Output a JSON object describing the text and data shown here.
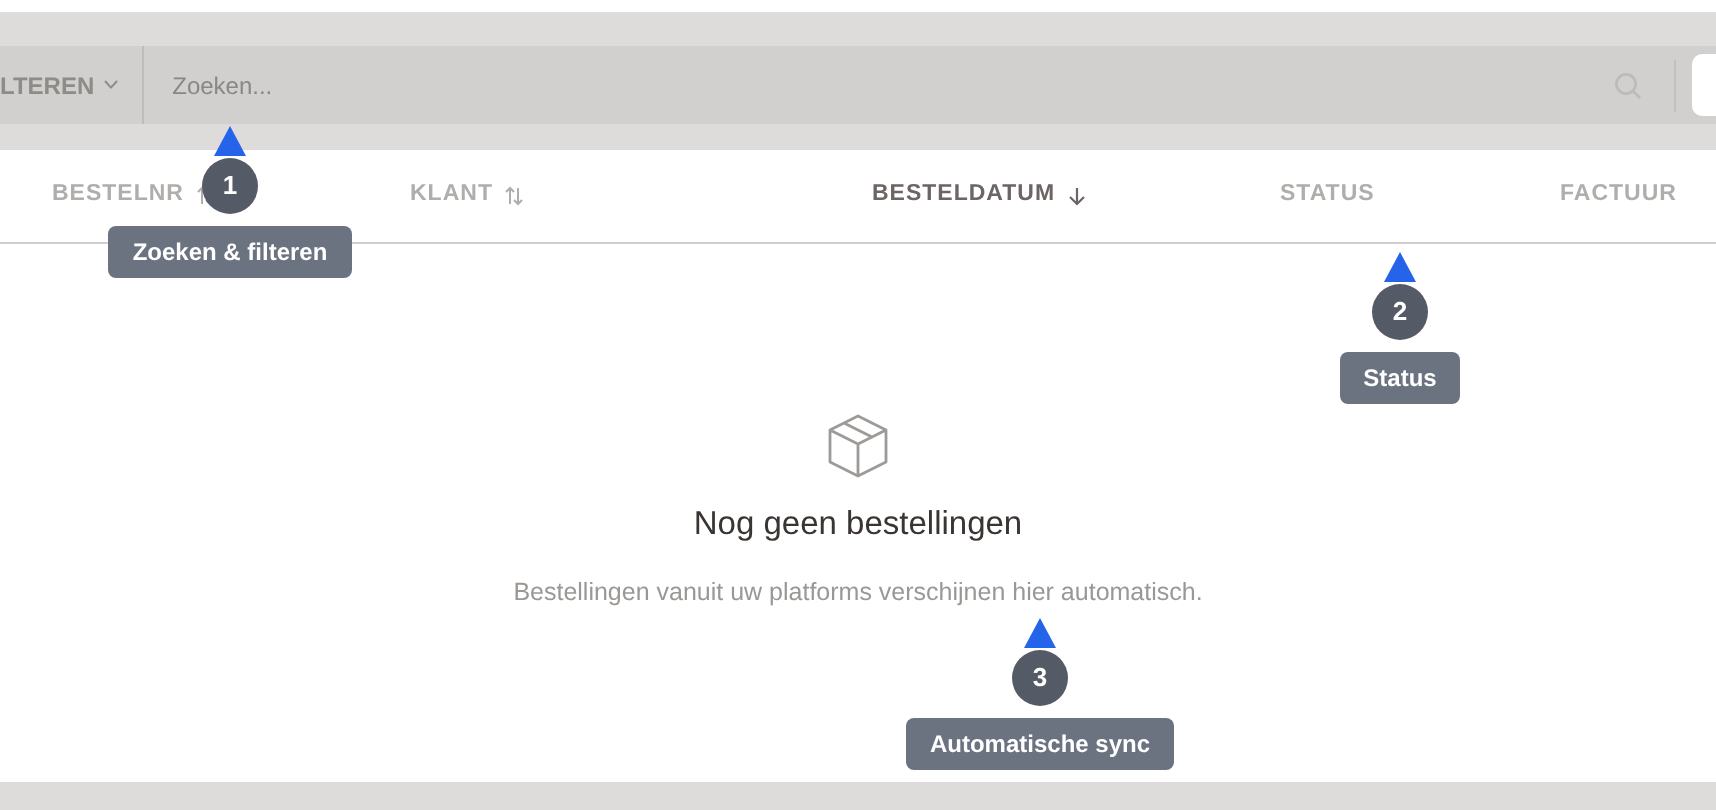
{
  "toolbar": {
    "filter_button": {
      "label": "LTEREN"
    },
    "search": {
      "placeholder": "Zoeken..."
    }
  },
  "table": {
    "columns": [
      {
        "label": "BESTELNR",
        "kind": "sortable",
        "active": false
      },
      {
        "label": "KLANT",
        "kind": "sortable",
        "active": false
      },
      {
        "label": "BESTELDATUM",
        "kind": "descending",
        "active": true
      },
      {
        "label": "STATUS",
        "kind": "plain",
        "active": false
      },
      {
        "label": "FACTUUR",
        "kind": "plain",
        "active": false
      }
    ]
  },
  "empty_state": {
    "title": "Nog geen bestellingen",
    "message": "Bestellingen vanuit uw platforms verschijnen hier automatisch."
  },
  "annotations": [
    {
      "number": "1",
      "label": "Zoeken & filteren"
    },
    {
      "number": "2",
      "label": "Status"
    },
    {
      "number": "3",
      "label": "Automatische sync"
    }
  ]
}
